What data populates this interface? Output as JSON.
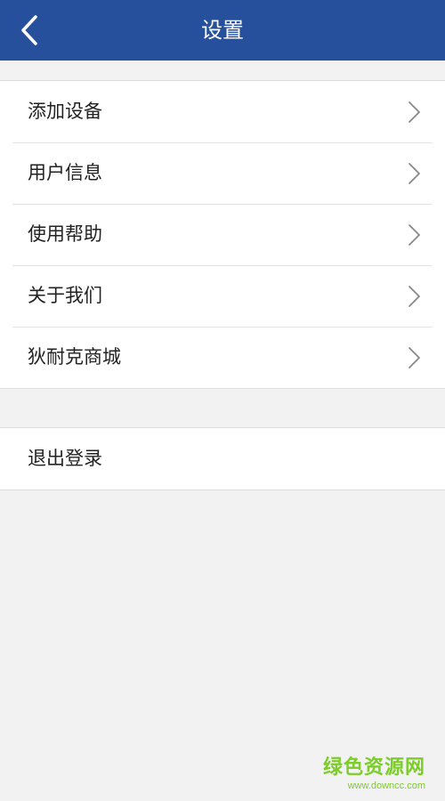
{
  "header": {
    "title": "设置",
    "back_icon": "chevron-left-icon",
    "background_color": "#26509b"
  },
  "menu": {
    "items": [
      {
        "label": "添加设备",
        "icon": "chevron-right-icon"
      },
      {
        "label": "用户信息",
        "icon": "chevron-right-icon"
      },
      {
        "label": "使用帮助",
        "icon": "chevron-right-icon"
      },
      {
        "label": "关于我们",
        "icon": "chevron-right-icon"
      },
      {
        "label": "狄耐克商城",
        "icon": "chevron-right-icon"
      }
    ]
  },
  "logout": {
    "label": "退出登录"
  },
  "watermark": {
    "title": "绿色资源网",
    "url": "www.downcc.com",
    "color": "#7ccc2a"
  }
}
